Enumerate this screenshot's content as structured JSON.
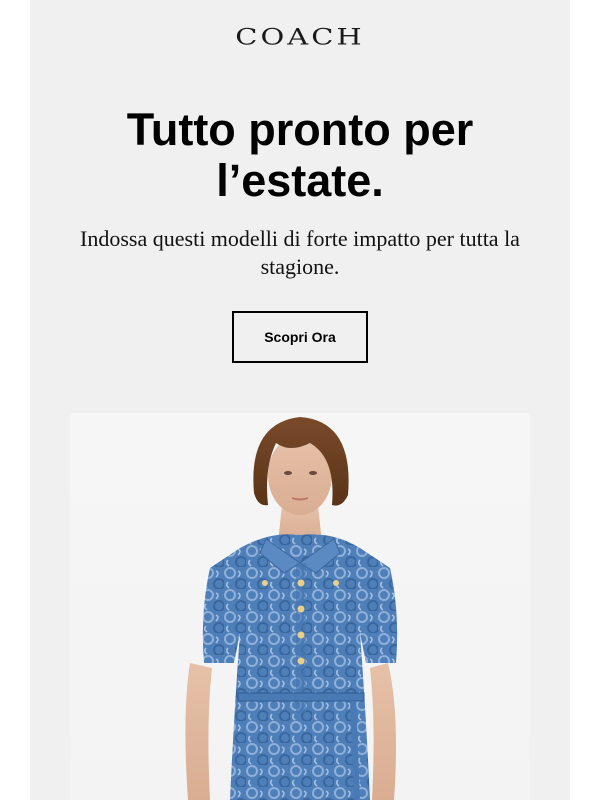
{
  "brand": {
    "logo_text": "COACH"
  },
  "headline": {
    "text": "Tutto pronto per l’estate."
  },
  "subtext": {
    "text": "Indossa questi modelli di forte impatto per tutta la stagione."
  },
  "cta": {
    "label": "Scopri Ora"
  },
  "hero_image": {
    "icon": "model-in-denim-dress-photo"
  },
  "colors": {
    "background": "#f1f0f0",
    "text": "#000000",
    "denim": "#4a7bb5"
  }
}
